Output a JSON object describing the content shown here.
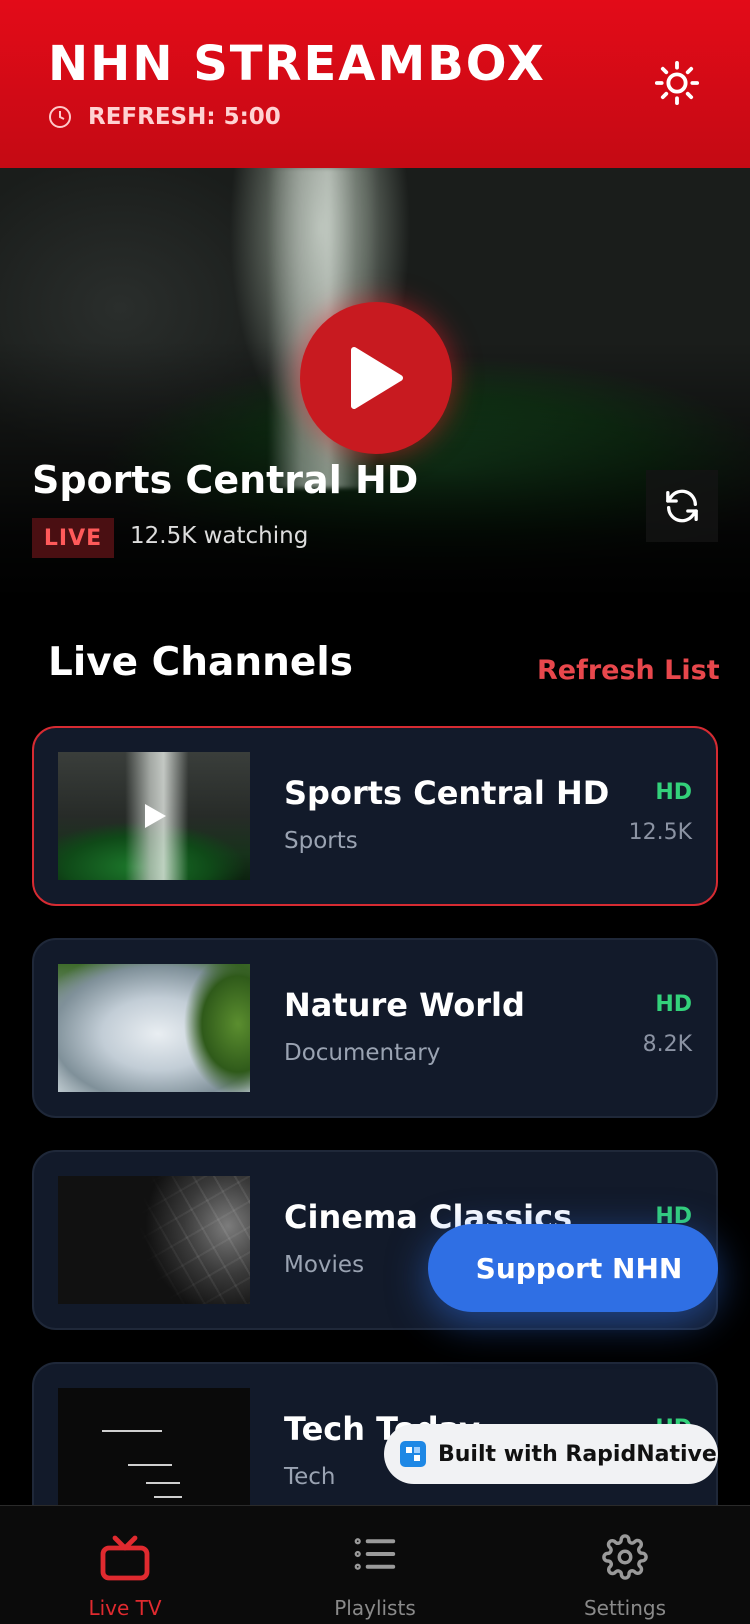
{
  "header": {
    "title": "NHN STREAMBOX",
    "refresh_label": "REFRESH: 5:00"
  },
  "hero": {
    "channel_title": "Sports Central HD",
    "live_badge": "LIVE",
    "watching": "12.5K watching"
  },
  "section": {
    "title": "Live Channels",
    "refresh_link": "Refresh List"
  },
  "channels": [
    {
      "name": "Sports Central HD",
      "category": "Sports",
      "quality": "HD",
      "viewers": "12.5K"
    },
    {
      "name": "Nature World",
      "category": "Documentary",
      "quality": "HD",
      "viewers": "8.2K"
    },
    {
      "name": "Cinema Classics",
      "category": "Movies",
      "quality": "HD",
      "viewers": ""
    },
    {
      "name": "Tech Today",
      "category": "Tech",
      "quality": "HD",
      "viewers": ""
    }
  ],
  "floating": {
    "support_button": "Support NHN",
    "built_with": "Built with RapidNative"
  },
  "nav": {
    "items": [
      {
        "label": "Live TV",
        "icon": "tv-icon"
      },
      {
        "label": "Playlists",
        "icon": "list-icon"
      },
      {
        "label": "Settings",
        "icon": "gear-icon"
      }
    ]
  },
  "colors": {
    "brand_red": "#e30b18",
    "accent_blue": "#2f6fe4",
    "hd_green": "#33d17a",
    "card_bg": "#121a2a"
  }
}
